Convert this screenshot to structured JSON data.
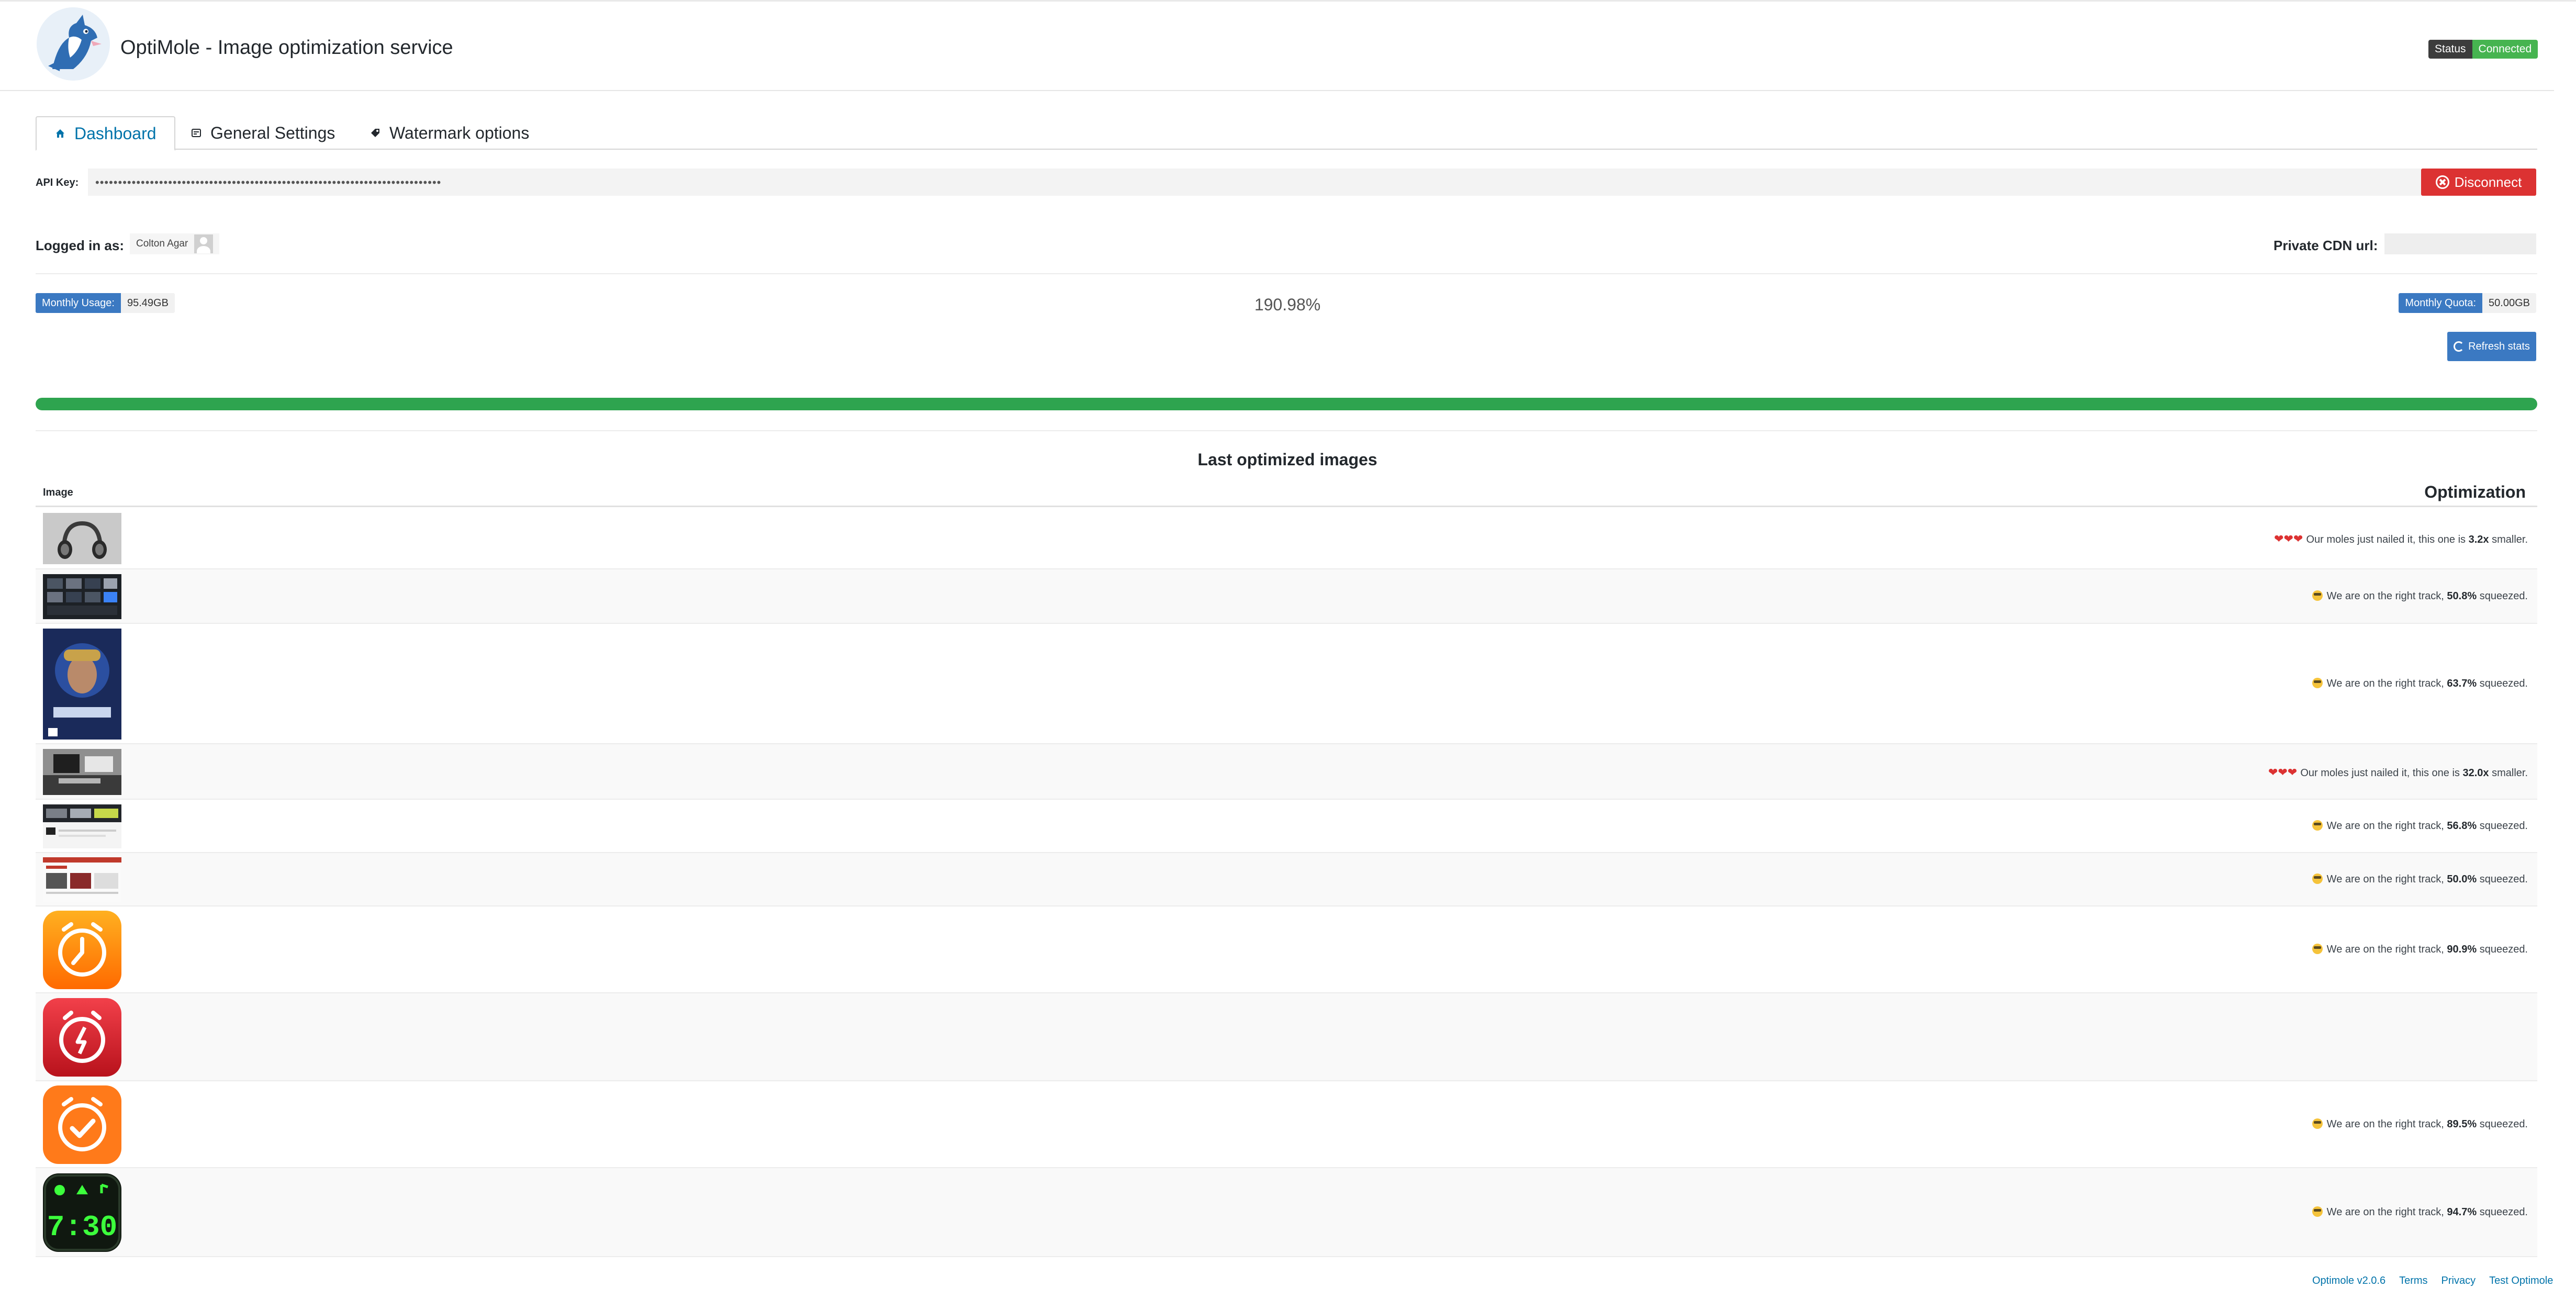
{
  "header": {
    "title": "OptiMole - Image optimization service",
    "status_label": "Status",
    "status_value": "Connected"
  },
  "tabs": [
    {
      "label": "Dashboard",
      "icon": "home-icon"
    },
    {
      "label": "General Settings",
      "icon": "settings-icon"
    },
    {
      "label": "Watermark options",
      "icon": "tag-icon"
    }
  ],
  "api": {
    "label": "API Key:",
    "value": "••••••••••••••••••••••••••••••••••••••••••••••••••••••••••••••••••••••••••••",
    "disconnect_label": "Disconnect"
  },
  "account": {
    "logged_label": "Logged in as:",
    "user_name": "Colton Agar",
    "cdn_label": "Private CDN url:"
  },
  "usage": {
    "monthly_usage_label": "Monthly Usage:",
    "monthly_usage_value": "95.49GB",
    "percent": "190.98%",
    "monthly_quota_label": "Monthly Quota:",
    "monthly_quota_value": "50.00GB",
    "refresh_label": "Refresh stats",
    "progress_fraction": 1.0
  },
  "table": {
    "title": "Last optimized images",
    "col_image": "Image",
    "col_optimization": "Optimization",
    "rows": [
      {
        "thumb": "headphones",
        "prefix": "",
        "text_before": "Our moles just nailed it, this one is ",
        "value": "3.2x",
        "text_after": " smaller.",
        "hearts": "❤❤❤"
      },
      {
        "thumb": "dark-screenshot",
        "prefix": "emoji",
        "text_before": "We are on the right track, ",
        "value": "50.8%",
        "text_after": " squeezed.",
        "hearts": ""
      },
      {
        "thumb": "starcraft-cover",
        "prefix": "emoji",
        "text_before": "We are on the right track, ",
        "value": "63.7%",
        "text_after": " squeezed.",
        "hearts": ""
      },
      {
        "thumb": "desk-photo",
        "prefix": "",
        "text_before": "Our moles just nailed it, this one is ",
        "value": "32.0x",
        "text_after": " smaller.",
        "hearts": "❤❤❤"
      },
      {
        "thumb": "web-screenshot",
        "prefix": "emoji",
        "text_before": "We are on the right track, ",
        "value": "56.8%",
        "text_after": " squeezed.",
        "hearts": ""
      },
      {
        "thumb": "red-web-screenshot",
        "prefix": "emoji",
        "text_before": "We are on the right track, ",
        "value": "50.0%",
        "text_after": " squeezed.",
        "hearts": ""
      },
      {
        "thumb": "orange-clock-app-icon",
        "prefix": "emoji",
        "text_before": "We are on the right track, ",
        "value": "90.9%",
        "text_after": " squeezed.",
        "hearts": ""
      },
      {
        "thumb": "red-alarm-app-icon",
        "prefix": "",
        "text_before": "",
        "value": "",
        "text_after": "",
        "hearts": ""
      },
      {
        "thumb": "orange-check-alarm-icon",
        "prefix": "emoji",
        "text_before": "We are on the right track, ",
        "value": "89.5%",
        "text_after": " squeezed.",
        "hearts": ""
      },
      {
        "thumb": "digital-clock-app-icon",
        "prefix": "emoji",
        "text_before": "We are on the right track, ",
        "value": "94.7%",
        "text_after": " squeezed.",
        "hearts": ""
      }
    ]
  },
  "footer": {
    "version": "Optimole v2.0.6",
    "terms": "Terms",
    "privacy": "Privacy",
    "test": "Test Optimole"
  },
  "colors": {
    "accent": "#0073aa",
    "connected": "#46b450",
    "disconnect": "#dc3232",
    "pill": "#3b79c2",
    "progress": "#2ea44f"
  }
}
